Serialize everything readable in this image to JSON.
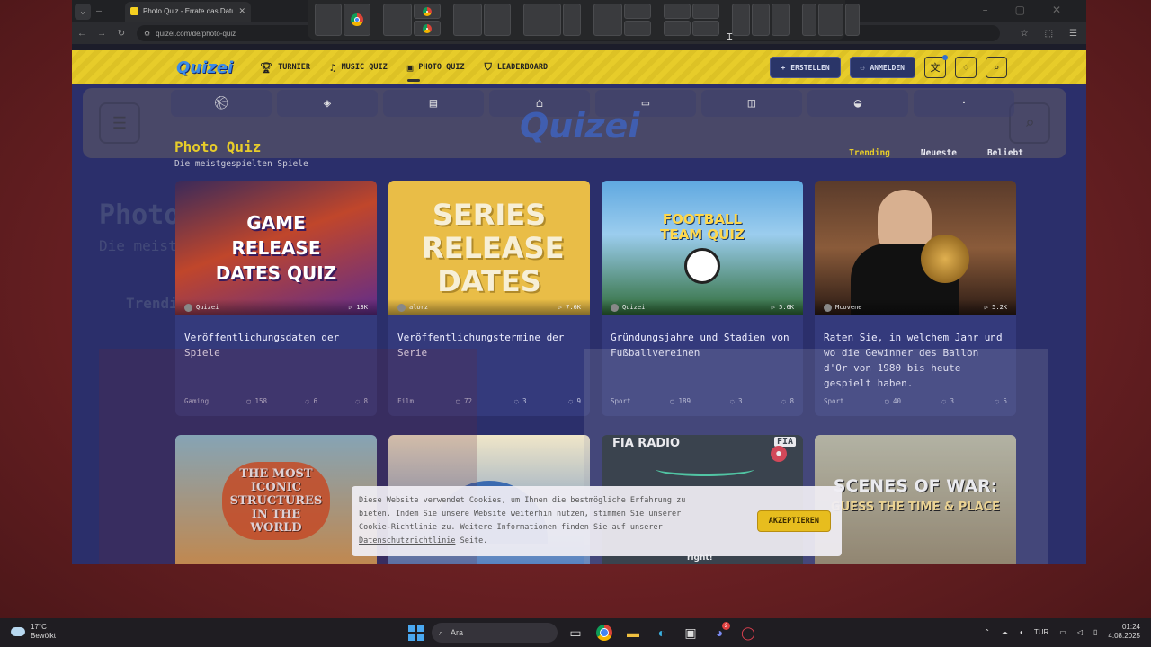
{
  "browser": {
    "tab_title": "Photo Quiz - Errate das Datum",
    "url": "quizei.com/de/photo-quiz"
  },
  "site": {
    "logo": "Quizei",
    "nav": [
      {
        "label": "TURNIER",
        "icon": "trophy-icon"
      },
      {
        "label": "MUSIC QUIZ",
        "icon": "music-note-icon"
      },
      {
        "label": "PHOTO QUIZ",
        "icon": "photo-icon"
      },
      {
        "label": "LEADERBOARD",
        "icon": "medal-icon"
      }
    ],
    "create_label": "ERSTELLEN",
    "login_label": "ANMELDEN"
  },
  "page": {
    "title": "Photo Quiz",
    "subtitle": "Die meistgespielten Spiele",
    "sort": [
      "Trending",
      "Neueste",
      "Beliebt"
    ],
    "cards": [
      {
        "art_text": "GAME RELEASE DATES QUIZ",
        "author": "Quizei",
        "plays": "13K",
        "title": "Veröffentlichungsdaten der Spiele",
        "category": "Gaming",
        "count": "158",
        "a": "6",
        "b": "8"
      },
      {
        "art_text": "SERIES RELEASE DATES",
        "author": "alorz",
        "plays": "7.6K",
        "title": "Veröffentlichungstermine der Serie",
        "category": "Film",
        "count": "72",
        "a": "3",
        "b": "9"
      },
      {
        "art_text": "FOOTBALL TEAM QUIZ",
        "author": "Quizei",
        "plays": "5.6K",
        "title": "Gründungsjahre und Stadien von Fußballvereinen",
        "category": "Sport",
        "count": "189",
        "a": "3",
        "b": "8"
      },
      {
        "art_text": "",
        "author": "Mcovene",
        "plays": "5.2K",
        "title": "Raten Sie, in welchem Jahr und wo die Gewinner des Ballon d'Or von 1980 bis heute gespielt haben.",
        "category": "Sport",
        "count": "40",
        "a": "3",
        "b": "5"
      },
      {
        "art_text": "THE MOST ICONIC STRUCTURES IN THE WORLD",
        "author": "",
        "plays": "",
        "title": "",
        "category": "",
        "count": "",
        "a": "",
        "b": ""
      },
      {
        "art_text": "",
        "author": "",
        "plays": "",
        "title": "",
        "category": "",
        "count": "",
        "a": "",
        "b": ""
      },
      {
        "art_text": "FIA RADIO",
        "author": "",
        "plays": "",
        "title": "",
        "category": "",
        "count": "",
        "a": "",
        "b": ""
      },
      {
        "art_text": "SCENES OF WAR:",
        "art_sub": "GUESS THE TIME & PLACE",
        "author": "",
        "plays": "",
        "title": "",
        "category": "",
        "count": "",
        "a": "",
        "b": ""
      }
    ],
    "fia_badge": "FIA",
    "fia_caption": "right!"
  },
  "cookie": {
    "text_1": "Diese Website verwendet Cookies, um Ihnen die bestmögliche Erfahrung zu",
    "text_2": "bieten. Indem Sie unsere Website weiterhin nutzen, stimmen Sie unserer",
    "text_3": "Cookie-Richtlinie zu. Weitere Informationen finden Sie auf unserer",
    "link": "Datenschutzrichtlinie",
    "text_4": "Seite.",
    "accept": "AKZEPTIEREN"
  },
  "taskbar": {
    "temp": "17°C",
    "weather": "Bewölkt",
    "search": "Ara",
    "lang": "TUR",
    "time": "01:24",
    "date": "4.08.2025",
    "badge": "2"
  },
  "colors": {
    "accent_yellow": "#e7cc2a",
    "page_bg": "#2b2f6b",
    "card_bg": "#343a7c"
  }
}
